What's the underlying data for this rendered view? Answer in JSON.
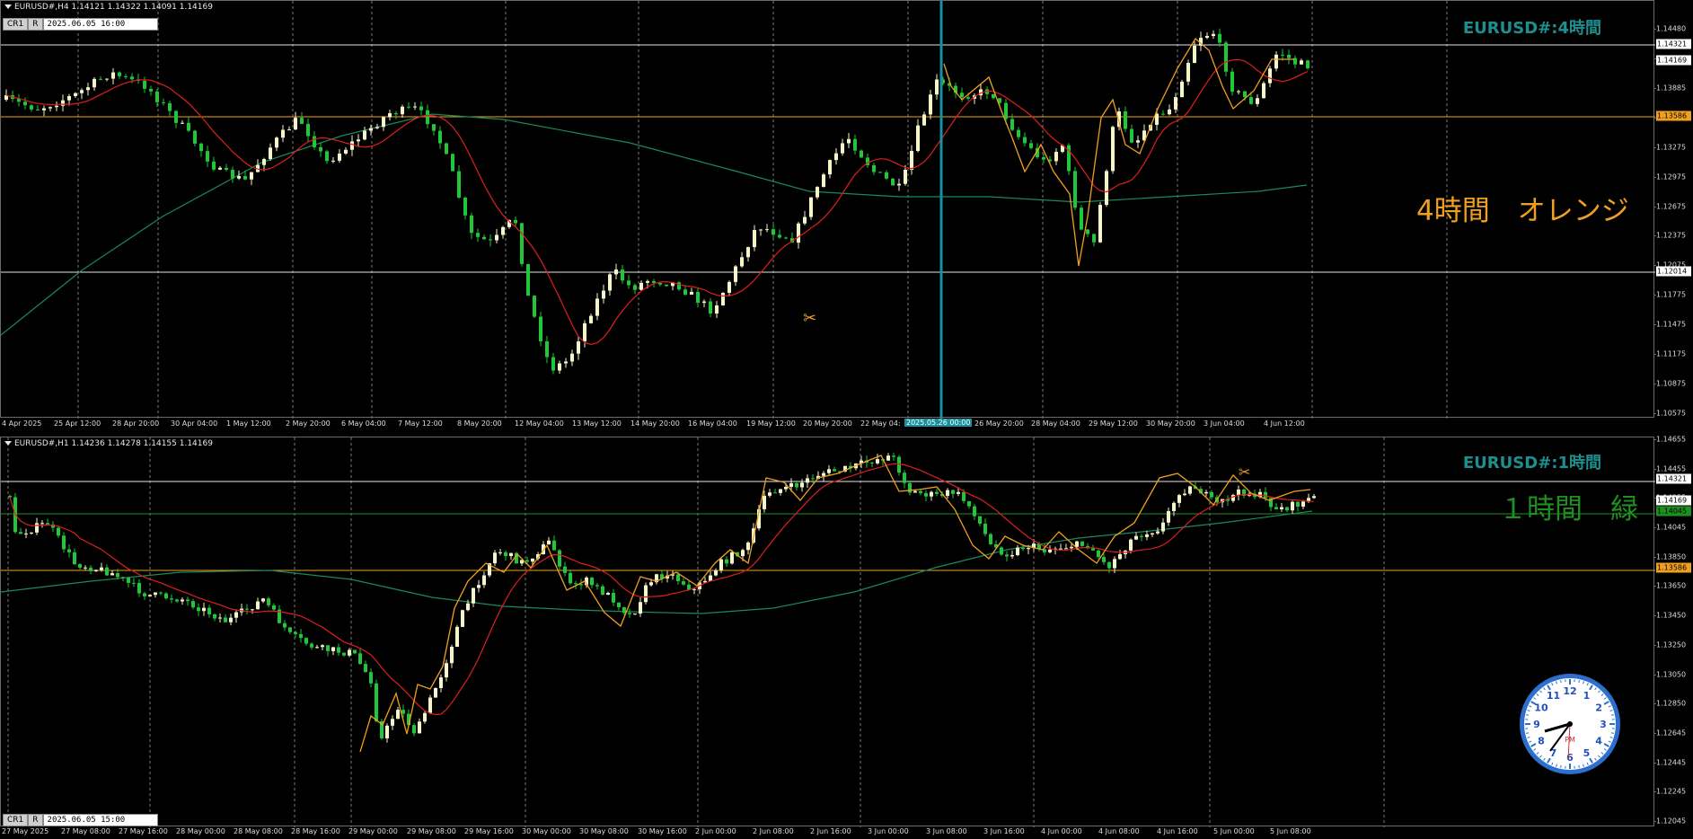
{
  "top": {
    "info": "EURUSD#,H4  1.14121 1.14322 1.14091 1.14169",
    "tags": [
      "CR1",
      "R"
    ],
    "time_box": "2025.06.05 16:00",
    "title": "EURUSD#:4時間",
    "note": "4時間　オレンジ",
    "y_labels": [
      "1.14480",
      "1.14169",
      "1.13885",
      "1.13586",
      "1.13275",
      "1.12975",
      "1.12675",
      "1.12375",
      "1.12075",
      "1.11775",
      "1.11475",
      "1.11175",
      "1.10875",
      "1.10575"
    ],
    "price_boxes": [
      {
        "label": "1.14321",
        "color": "#ffffff",
        "text": "#000000"
      },
      {
        "label": "1.14169",
        "color": "#ffffff",
        "text": "#000000"
      },
      {
        "label": "1.13586",
        "color": "#f0a020",
        "text": "#000000"
      },
      {
        "label": "1.12014",
        "color": "#ffffff",
        "text": "#000000"
      }
    ],
    "x_labels": [
      "4 Apr 2025",
      "25 Apr 12:00",
      "28 Apr 20:00",
      "30 Apr 04:00",
      "1 May 12:00",
      "2 May 20:00",
      "6 May 04:00",
      "7 May 12:00",
      "8 May 20:00",
      "12 May 04:00",
      "13 May 12:00",
      "14 May 20:00",
      "16 May 04:00",
      "19 May 12:00",
      "20 May 20:00",
      "22 May 04:",
      "26 May 20:00",
      "28 May 04:00",
      "29 May 12:00",
      "30 May 20:00",
      "3 Jun 04:00",
      "4 Jun 12:00"
    ],
    "x_marker": "2025.05.26 00:00",
    "colors": {
      "candle": "#f5f5c8",
      "candle_bear": "#1ec838",
      "ma_fast": "#e01e1e",
      "ma_slow": "#1a8a5a",
      "zigzag": "#f0a020",
      "hline_white": "#e6e6e6",
      "hline_orange": "#f0a020",
      "crosshair": "#1a8fa0"
    }
  },
  "bottom": {
    "info": "EURUSD#,H1  1.14236 1.14278 1.14155 1.14169",
    "tags": [
      "CR1",
      "R"
    ],
    "time_box": "2025.06.05 15:00",
    "title": "EURUSD#:1時間",
    "note": "１時間　緑",
    "y_labels": [
      "1.14655",
      "1.14455",
      "1.14255",
      "1.14045",
      "1.13850",
      "1.13650",
      "1.13450",
      "1.13250",
      "1.13050",
      "1.12850",
      "1.12645",
      "1.12445",
      "1.12245",
      "1.12045"
    ],
    "price_boxes": [
      {
        "label": "1.14321",
        "color": "#ffffff",
        "text": "#000000"
      },
      {
        "label": "1.14169",
        "color": "#ffffff",
        "text": "#000000"
      },
      {
        "label": "1.14045",
        "color": "#1f8f1f",
        "text": "#000000"
      },
      {
        "label": "1.13586",
        "color": "#f0a020",
        "text": "#000000"
      }
    ],
    "x_labels": [
      "27 May 2025",
      "27 May 08:00",
      "27 May 16:00",
      "28 May 00:00",
      "28 May 08:00",
      "28 May 16:00",
      "29 May 00:00",
      "29 May 08:00",
      "29 May 16:00",
      "30 May 00:00",
      "30 May 08:00",
      "30 May 16:00",
      "2 Jun 00:00",
      "2 Jun 08:00",
      "2 Jun 16:00",
      "3 Jun 00:00",
      "3 Jun 08:00",
      "3 Jun 16:00",
      "4 Jun 00:00",
      "4 Jun 08:00",
      "4 Jun 16:00",
      "5 Jun 00:00",
      "5 Jun 08:00"
    ]
  },
  "clock": {
    "numbers": [
      "12",
      "1",
      "2",
      "3",
      "4",
      "5",
      "6",
      "7",
      "8",
      "9",
      "10",
      "11"
    ],
    "label": "PM"
  }
}
